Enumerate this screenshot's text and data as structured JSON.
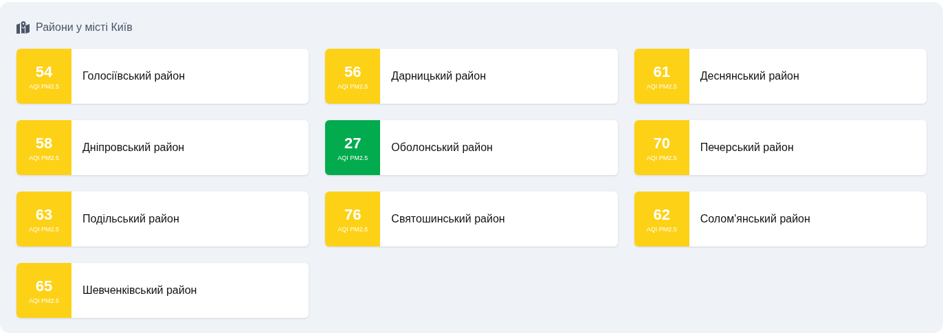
{
  "title": "Райони у місті Київ",
  "districts": [
    {
      "aqi": "54",
      "unit": "AQI PM2.5",
      "name": "Голосіївський район",
      "color": "#fdd116"
    },
    {
      "aqi": "56",
      "unit": "AQI PM2.5",
      "name": "Дарницький район",
      "color": "#fdd116"
    },
    {
      "aqi": "61",
      "unit": "AQI PM2.5",
      "name": "Деснянський район",
      "color": "#fdd116"
    },
    {
      "aqi": "58",
      "unit": "AQI PM2.5",
      "name": "Дніпровський район",
      "color": "#fdd116"
    },
    {
      "aqi": "27",
      "unit": "AQI PM2.5",
      "name": "Оболонський район",
      "color": "#02ab4e"
    },
    {
      "aqi": "70",
      "unit": "AQI PM2.5",
      "name": "Печерський район",
      "color": "#fdd116"
    },
    {
      "aqi": "63",
      "unit": "AQI PM2.5",
      "name": "Подільський район",
      "color": "#fdd116"
    },
    {
      "aqi": "76",
      "unit": "AQI PM2.5",
      "name": "Святошинський район",
      "color": "#fdd116"
    },
    {
      "aqi": "62",
      "unit": "AQI PM2.5",
      "name": "Солом'янський район",
      "color": "#fdd116"
    },
    {
      "aqi": "65",
      "unit": "AQI PM2.5",
      "name": "Шевченківський район",
      "color": "#fdd116"
    }
  ]
}
